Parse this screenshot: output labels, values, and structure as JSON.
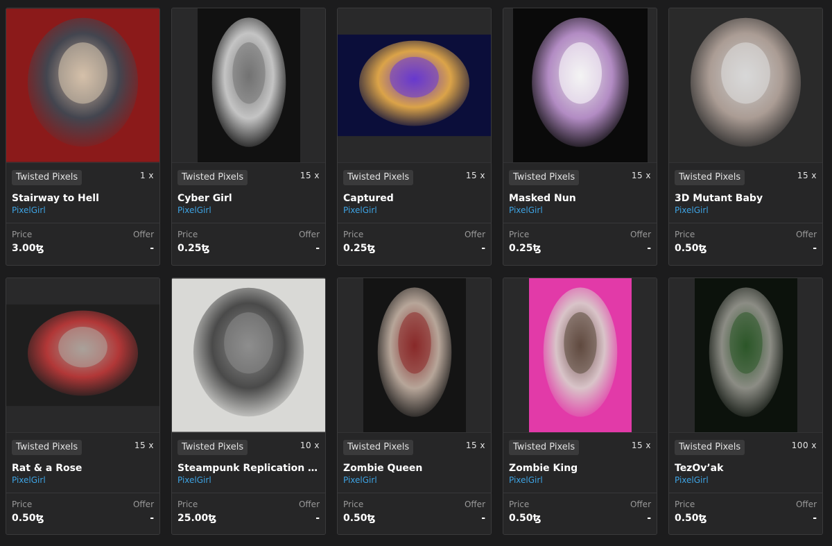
{
  "cards": [
    {
      "collection": "Twisted Pixels",
      "editions": "1 x",
      "title": "Stairway to Hell",
      "artist": "PixelGirl",
      "price_label": "Price",
      "price": "3.00ꜩ",
      "offer_label": "Offer",
      "offer": "-",
      "palette": [
        "#8b1a1a",
        "#3b4a55",
        "#d8c8b0"
      ]
    },
    {
      "collection": "Twisted Pixels",
      "editions": "15 x",
      "title": "Cyber Girl",
      "artist": "PixelGirl",
      "price_label": "Price",
      "price": "0.25ꜩ",
      "offer_label": "Offer",
      "offer": "-",
      "palette": [
        "#111111",
        "#d8d8d8",
        "#777777"
      ]
    },
    {
      "collection": "Twisted Pixels",
      "editions": "15 x",
      "title": "Captured",
      "artist": "PixelGirl",
      "price_label": "Price",
      "price": "0.25ꜩ",
      "offer_label": "Offer",
      "offer": "-",
      "palette": [
        "#0b0e3a",
        "#f2b44a",
        "#6c3bd6"
      ]
    },
    {
      "collection": "Twisted Pixels",
      "editions": "15 x",
      "title": "Masked Nun",
      "artist": "PixelGirl",
      "price_label": "Price",
      "price": "0.25ꜩ",
      "offer_label": "Offer",
      "offer": "-",
      "palette": [
        "#0a0a0a",
        "#c59ad8",
        "#ffffff"
      ]
    },
    {
      "collection": "Twisted Pixels",
      "editions": "15 x",
      "title": "3D Mutant Baby",
      "artist": "PixelGirl",
      "price_label": "Price",
      "price": "0.50ꜩ",
      "offer_label": "Offer",
      "offer": "-",
      "palette": [
        "#2a2a2a",
        "#b9a9a0",
        "#e0e0e0"
      ]
    },
    {
      "collection": "Twisted Pixels",
      "editions": "15 x",
      "title": "Rat & a Rose",
      "artist": "PixelGirl",
      "price_label": "Price",
      "price": "0.50ꜩ",
      "offer_label": "Offer",
      "offer": "-",
      "palette": [
        "#1e1e1e",
        "#c23a3a",
        "#b0a8a0"
      ]
    },
    {
      "collection": "Twisted Pixels",
      "editions": "10 x",
      "title": "Steampunk Replication Sc...",
      "artist": "PixelGirl",
      "price_label": "Price",
      "price": "25.00ꜩ",
      "offer_label": "Offer",
      "offer": "-",
      "palette": [
        "#d9d9d6",
        "#3a3a3a",
        "#8a8a8a"
      ]
    },
    {
      "collection": "Twisted Pixels",
      "editions": "15 x",
      "title": "Zombie Queen",
      "artist": "PixelGirl",
      "price_label": "Price",
      "price": "0.50ꜩ",
      "offer_label": "Offer",
      "offer": "-",
      "palette": [
        "#141414",
        "#c9b6a8",
        "#8e2a2a"
      ]
    },
    {
      "collection": "Twisted Pixels",
      "editions": "15 x",
      "title": "Zombie King",
      "artist": "PixelGirl",
      "price_label": "Price",
      "price": "0.50ꜩ",
      "offer_label": "Offer",
      "offer": "-",
      "palette": [
        "#e23aa8",
        "#d8d3cc",
        "#5a4a3a"
      ]
    },
    {
      "collection": "Twisted Pixels",
      "editions": "100 x",
      "title": "TezOv’ak",
      "artist": "PixelGirl",
      "price_label": "Price",
      "price": "0.50ꜩ",
      "offer_label": "Offer",
      "offer": "-",
      "palette": [
        "#0c120c",
        "#9a9a92",
        "#2d5a2a"
      ]
    }
  ]
}
